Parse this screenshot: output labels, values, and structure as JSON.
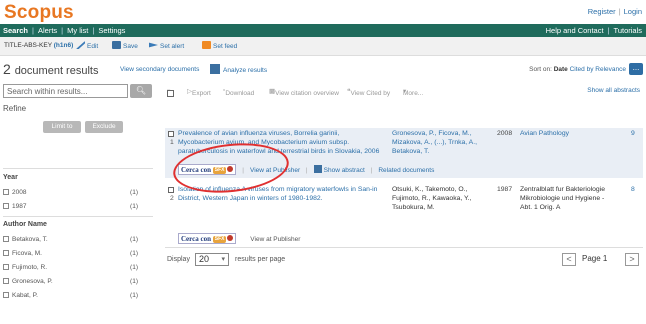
{
  "header": {
    "logo": "Scopus",
    "register": "Register",
    "login": "Login"
  },
  "nav": {
    "items": [
      "Search",
      "Alerts",
      "My list",
      "Settings"
    ],
    "help": "Help and Contact",
    "tutorials": "Tutorials"
  },
  "query": {
    "prefix": "TITLE-ABS-KEY",
    "term": "(h1n6)",
    "edit": "Edit",
    "save": "Save",
    "set_alert": "Set alert",
    "set_feed": "Set feed"
  },
  "results_header": {
    "count": "2",
    "count_label": "document results",
    "secondary": "View secondary documents",
    "analyze": "Analyze results",
    "sort_on": "Sort on:",
    "sort_date": "Date",
    "sort_cited": "Cited by",
    "sort_relevance": "Relevance",
    "sort_button": "..."
  },
  "sidebar": {
    "search_placeholder": "Search within results...",
    "refine": "Refine",
    "limit_to": "Limit to",
    "exclude": "Exclude",
    "year_title": "Year",
    "years": [
      {
        "label": "2008",
        "count": "(1)"
      },
      {
        "label": "1987",
        "count": "(1)"
      }
    ],
    "author_title": "Author Name",
    "authors": [
      {
        "label": "Betakova, T.",
        "count": "(1)"
      },
      {
        "label": "Ficova, M.",
        "count": "(1)"
      },
      {
        "label": "Fujimoto, R.",
        "count": "(1)"
      },
      {
        "label": "Gronesova, P.",
        "count": "(1)"
      },
      {
        "label": "Kabat, P.",
        "count": "(1)"
      }
    ]
  },
  "toolbar": {
    "export": "Export",
    "download": "Download",
    "citation_overview": "View citation overview",
    "cited_by": "View Cited by",
    "more": "More...",
    "show_all": "Show all abstracts"
  },
  "results": [
    {
      "num": "1",
      "title_lines": [
        "Prevalence of avian influenza viruses, Borrelia garinii,",
        "Mycobacterium avium, and Mycobacterium avium subsp.",
        "paratuberculosis in waterfowl and terrestrial birds in Slovakia, 2006"
      ],
      "authors_lines": [
        "Gronesova, P., Ficova, M.,",
        "Mizakova, A., (...), Trnka, A.,",
        "Betakova, T."
      ],
      "year": "2008",
      "source_lines": [
        "Avian Pathology"
      ],
      "cited": "9"
    },
    {
      "num": "2",
      "title_lines": [
        "Isolation of influenza A viruses from migratory waterfowls in San-in",
        "District, Western Japan in winters of 1980-1982."
      ],
      "authors_lines": [
        "Otsuki, K., Takemoto, O.,",
        "Fujimoto, R., Kawaoka, Y.,",
        "Tsubokura, M."
      ],
      "year": "1987",
      "source_lines": [
        "Zentralblatt fur Bakteriologie",
        "Mikrobiologie und Hygiene -",
        "Abt. 1 Orig. A"
      ],
      "cited": "8"
    }
  ],
  "actions": {
    "cerca": "Cerca con",
    "sfx": "SFX",
    "view_publisher": "View at Publisher",
    "show_abstract": "Show abstract",
    "related": "Related documents"
  },
  "pagination": {
    "display": "Display",
    "per_page_value": "20",
    "per_page_label": "results per page",
    "page_label": "Page 1"
  },
  "colors": {
    "brand_orange": "#e87722",
    "nav_green": "#1f6b5c",
    "link_blue": "#2b6fa8",
    "highlight_circle": "#e03030"
  }
}
